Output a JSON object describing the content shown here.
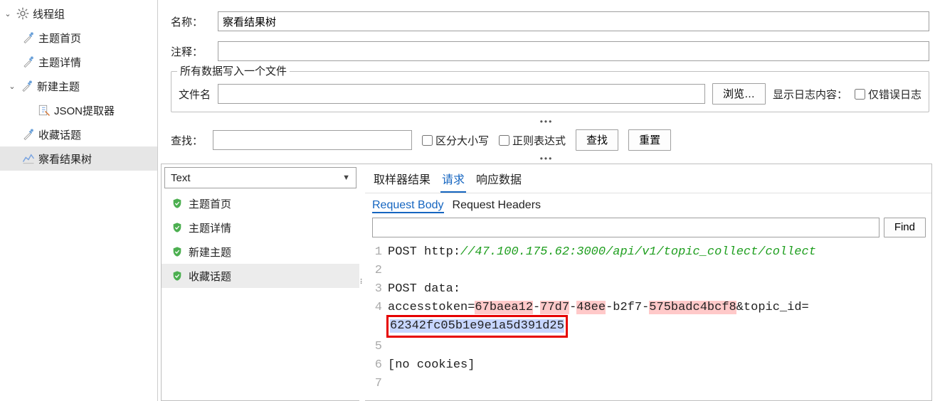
{
  "sidebar": {
    "root": "线程组",
    "items": [
      {
        "label": "主题首页",
        "icon": "dropper"
      },
      {
        "label": "主题详情",
        "icon": "dropper"
      },
      {
        "label": "新建主题",
        "icon": "dropper",
        "expanded": true
      },
      {
        "label": "JSON提取器",
        "icon": "extractor"
      },
      {
        "label": "收藏话题",
        "icon": "dropper"
      },
      {
        "label": "察看结果树",
        "icon": "results",
        "selected": true
      }
    ]
  },
  "header": {
    "title_cut": "察看结果树",
    "name_label": "名称：",
    "name_value": "察看结果树",
    "comment_label": "注释：",
    "comment_value": ""
  },
  "file_group": {
    "legend": "所有数据写入一个文件",
    "filename_label": "文件名",
    "filename_value": "",
    "browse": "浏览…",
    "log_label": "显示日志内容：",
    "only_errors": "仅错误日志"
  },
  "search": {
    "label": "查找：",
    "value": "",
    "case_sensitive": "区分大小写",
    "regex": "正则表达式",
    "find_btn": "查找",
    "reset_btn": "重置"
  },
  "renderer": {
    "selected": "Text",
    "items": [
      {
        "label": "主题首页",
        "ok": true
      },
      {
        "label": "主题详情",
        "ok": true
      },
      {
        "label": "新建主题",
        "ok": true
      },
      {
        "label": "收藏话题",
        "ok": true,
        "selected": true
      }
    ]
  },
  "right_pane": {
    "main_tabs": [
      "取样器结果",
      "请求",
      "响应数据"
    ],
    "main_active": 1,
    "sub_tabs": [
      "Request Body",
      "Request Headers"
    ],
    "sub_active": 0,
    "find_placeholder": "",
    "find_btn": "Find"
  },
  "request": {
    "method": "POST",
    "scheme": "http:",
    "url_rest": "//47.100.175.62:3000/api/v1/topic_collect/collect",
    "post_data_label": "POST data:",
    "line4_prefix": "accesstoken=",
    "token_p1": "67baea12",
    "token_p2": "77d7",
    "token_p3": "48ee",
    "token_p4": "b2f7",
    "token_p5": "575badc4bcf8",
    "amp_key": "&topic_id=",
    "topic_id": "62342fc05b1e9e1a5d391d25",
    "no_cookies": "[no cookies]"
  }
}
